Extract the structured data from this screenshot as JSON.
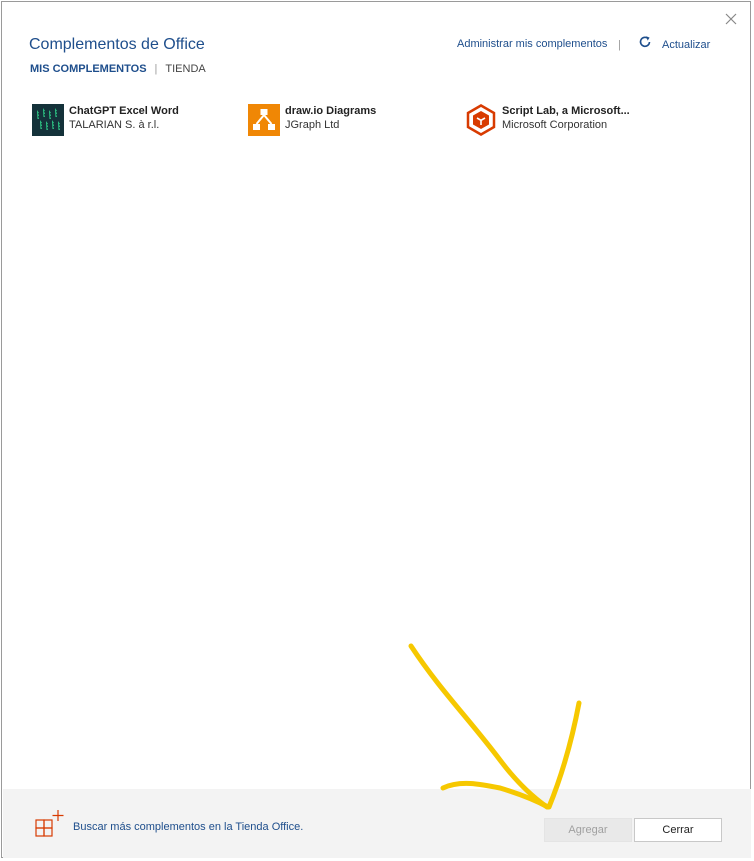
{
  "dialog": {
    "title": "Complementos de Office",
    "tabs": {
      "active": "MIS COMPLEMENTOS",
      "separator": "|",
      "other": "TIENDA"
    },
    "manage_link": "Administrar mis complementos",
    "header_separator": "|",
    "refresh_label": "Actualizar"
  },
  "addins": [
    {
      "name": "ChatGPT Excel Word",
      "publisher": "TALARIAN S. à r.l.",
      "icon": "chatgpt-excel-word-icon",
      "icon_bg": "#14323a",
      "icon_fg": "#2fd08a"
    },
    {
      "name": "draw.io Diagrams",
      "publisher": "JGraph Ltd",
      "icon": "drawio-icon",
      "icon_bg": "#f08705"
    },
    {
      "name": "Script Lab, a Microsoft...",
      "publisher": "Microsoft Corporation",
      "icon": "script-lab-icon",
      "icon_bg": "#d83b01"
    }
  ],
  "footer": {
    "store_link": "Buscar más complementos en la Tienda Office.",
    "add_button": "Agregar",
    "close_button": "Cerrar"
  },
  "colors": {
    "accent": "#1e4e8c",
    "annotation": "#f6c800",
    "footer_bg": "#f3f3f3"
  }
}
